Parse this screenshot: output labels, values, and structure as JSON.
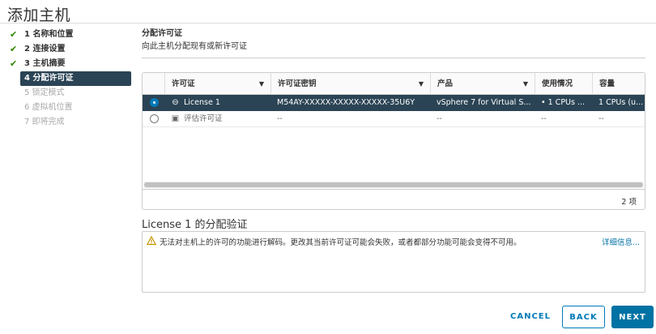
{
  "dialog": {
    "title": "添加主机"
  },
  "steps": [
    {
      "label": "1 名称和位置",
      "state": "done"
    },
    {
      "label": "2 连接设置",
      "state": "done"
    },
    {
      "label": "3 主机摘要",
      "state": "done"
    },
    {
      "label": "4 分配许可证",
      "state": "active"
    },
    {
      "label": "5 锁定模式",
      "state": "disabled"
    },
    {
      "label": "6 虚拟机位置",
      "state": "disabled"
    },
    {
      "label": "7 即将完成",
      "state": "disabled"
    }
  ],
  "section": {
    "title": "分配许可证",
    "subtitle": "向此主机分配现有或新许可证"
  },
  "grid": {
    "columns": [
      "许可证",
      "许可证密钥",
      "产品",
      "使用情况",
      "容量"
    ],
    "rows": [
      {
        "selected": true,
        "icon": "license-key-icon",
        "license": "License 1",
        "key": "M54AY-XXXXX-XXXXX-XXXXX-35U6Y",
        "product": "vSphere 7 for Virtual S...",
        "usage": "• 1 CPUs ...",
        "capacity": "1 CPUs (u..."
      },
      {
        "selected": false,
        "icon": "evaluation-license-icon",
        "license": "评估许可证",
        "key": "--",
        "product": "--",
        "usage": "--",
        "capacity": "--"
      }
    ],
    "count": "2 项"
  },
  "validation": {
    "title": "License 1 的分配验证",
    "warning": "无法对主机上的许可的功能进行解码。更改其当前许可证可能会失败，或者都部分功能可能会变得不可用。",
    "more_link": "详细信息..."
  },
  "buttons": {
    "cancel": "CANCEL",
    "back": "BACK",
    "next": "NEXT"
  },
  "colors": {
    "accent": "#0072a3",
    "selected_row": "#2b4455",
    "done_check": "#2f8400",
    "warning": "#c99400"
  }
}
